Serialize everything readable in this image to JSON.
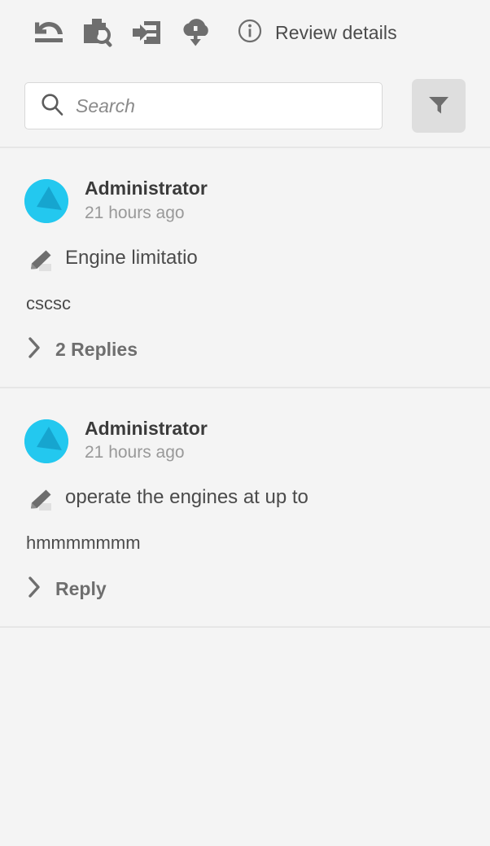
{
  "toolbar": {
    "buttons": [
      {
        "name": "revert-icon",
        "title": "Revert"
      },
      {
        "name": "document-search-icon",
        "title": "Find in document"
      },
      {
        "name": "import-comments-icon",
        "title": "Import comments"
      },
      {
        "name": "download-cloud-icon",
        "title": "Download"
      }
    ],
    "review_details": {
      "icon": "info-circle-icon",
      "label": "Review details"
    }
  },
  "search": {
    "icon": "search-icon",
    "placeholder": "Search",
    "value": "",
    "filter_icon": "filter-funnel-icon"
  },
  "colors": {
    "page_background": "#f4f4f4",
    "divider": "#e6e6e6",
    "avatar_primary": "#23c8ef",
    "avatar_secondary": "#18a0c8",
    "icon_gray": "#6e6e6e",
    "text_primary": "#4b4b4b",
    "text_muted": "#999999",
    "filter_button_background": "#dedede"
  },
  "comments": [
    {
      "avatar_icon": "user-avatar",
      "author": "Administrator",
      "timestamp": "21 hours ago",
      "annotation_icon": "highlighter-icon",
      "quote": "Engine limitatio",
      "body": "cscsc",
      "replies_icon": "chevron-right-icon",
      "replies_label": "2 Replies"
    },
    {
      "avatar_icon": "user-avatar",
      "author": "Administrator",
      "timestamp": "21 hours ago",
      "annotation_icon": "highlighter-icon",
      "quote": "operate the engines at up to",
      "body": "hmmmmmmm",
      "replies_icon": "chevron-right-icon",
      "replies_label": "Reply"
    }
  ]
}
